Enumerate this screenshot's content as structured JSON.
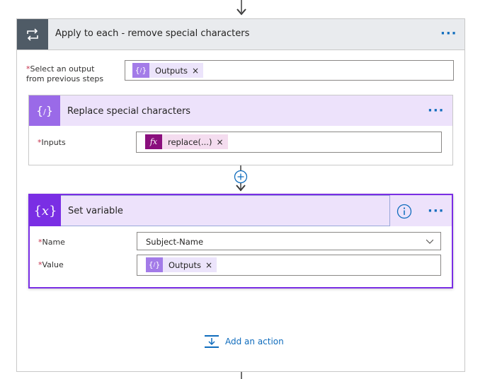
{
  "outer": {
    "title": "Apply to each - remove special characters",
    "select_output_label_line1": "Select an output",
    "select_output_label_line2": "from previous steps",
    "select_output_token": "Outputs",
    "more_label": "···"
  },
  "replace_card": {
    "title": "Replace special characters",
    "inputs_label": "Inputs",
    "inputs_token": "replace(...)",
    "more_label": "···"
  },
  "set_variable": {
    "title": "Set variable",
    "name_label": "Name",
    "name_value": "Subject-Name",
    "value_label": "Value",
    "value_token": "Outputs",
    "more_label": "···"
  },
  "add_action": {
    "label": "Add an action"
  },
  "icons": {
    "loop": "loop-icon",
    "variable": "curly-braces-variable-icon",
    "expression": "fx-icon",
    "info": "info-icon",
    "plus": "plus-circle-icon",
    "chevron": "chevron-down-icon",
    "add_action": "add-action-icon"
  },
  "colors": {
    "variable_purple": "#7a2ee4",
    "variable_light": "#ede2fb",
    "expression_magenta": "#8a0f7d",
    "expression_light": "#f4dcef",
    "token_light": "#ece4fb",
    "link_blue": "#0f6cbd",
    "loop_tile": "#4f5b66"
  }
}
